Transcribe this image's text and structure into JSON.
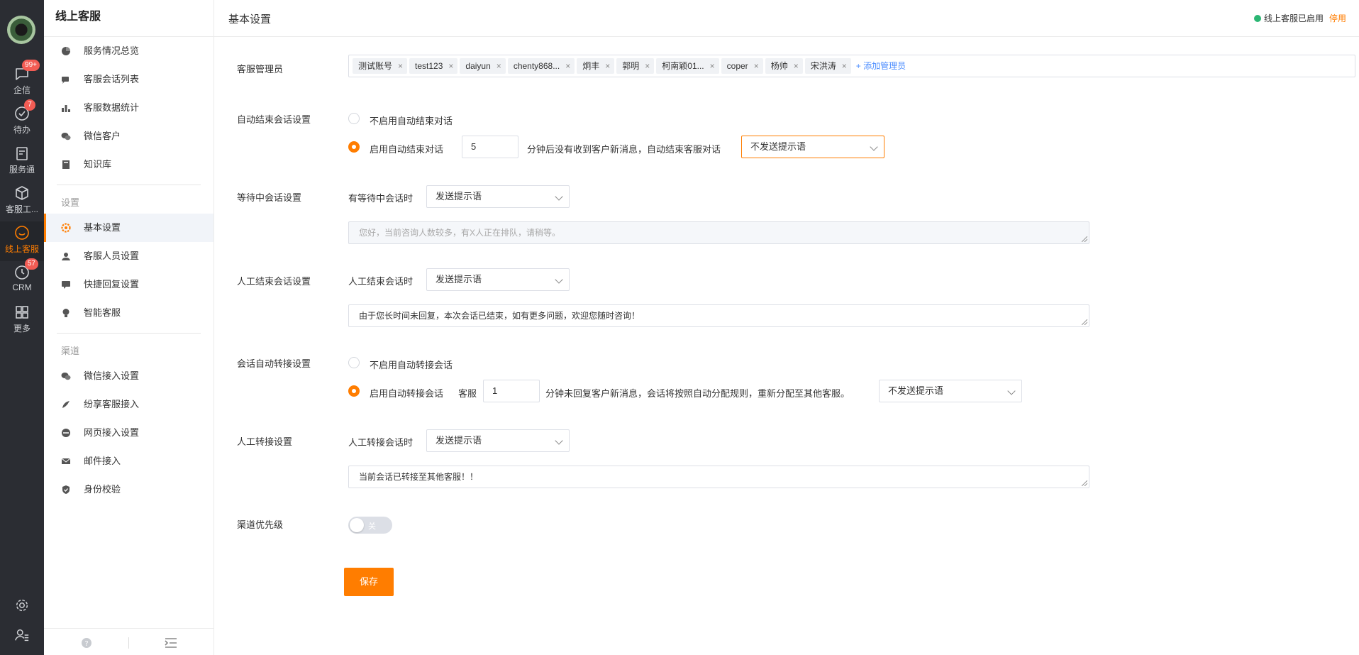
{
  "rail": {
    "items": [
      {
        "label": "企信",
        "badge": "99+"
      },
      {
        "label": "待办",
        "badge": "7"
      },
      {
        "label": "服务通",
        "badge": ""
      },
      {
        "label": "客服工...",
        "badge": ""
      },
      {
        "label": "线上客服",
        "badge": ""
      },
      {
        "label": "CRM",
        "badge": "57"
      },
      {
        "label": "更多",
        "badge": ""
      }
    ]
  },
  "sidebar": {
    "title": "线上客服",
    "items": [
      {
        "label": "服务情况总览"
      },
      {
        "label": "客服会话列表"
      },
      {
        "label": "客服数据统计"
      },
      {
        "label": "微信客户"
      },
      {
        "label": "知识库"
      }
    ],
    "group_settings": "设置",
    "settings_items": [
      {
        "label": "基本设置"
      },
      {
        "label": "客服人员设置"
      },
      {
        "label": "快捷回复设置"
      },
      {
        "label": "智能客服"
      }
    ],
    "group_channels": "渠道",
    "channel_items": [
      {
        "label": "微信接入设置"
      },
      {
        "label": "纷享客服接入"
      },
      {
        "label": "网页接入设置"
      },
      {
        "label": "邮件接入"
      },
      {
        "label": "身份校验"
      }
    ]
  },
  "header": {
    "title": "基本设置",
    "status_text": "线上客服已启用",
    "stop_label": "停用"
  },
  "admins": {
    "label": "客服管理员",
    "tags": [
      "测试账号",
      "test123",
      "daiyun",
      "chenty868...",
      "炯丰",
      "郭明",
      "柯南颖01...",
      "coper",
      "杨帅",
      "宋洪涛"
    ],
    "add_label": "+ 添加管理员"
  },
  "auto_end": {
    "label": "自动结束会话设置",
    "option_off": "不启用自动结束对话",
    "option_on": "启用自动结束对话",
    "minutes": "5",
    "desc": "分钟后没有收到客户新消息，自动结束客服对话",
    "select_value": "不发送提示语"
  },
  "waiting": {
    "label": "等待中会话设置",
    "prefix": "有等待中会话时",
    "select_value": "发送提示语",
    "placeholder": "您好，当前咨询人数较多，有X人正在排队，请稍等。"
  },
  "manual_end": {
    "label": "人工结束会话设置",
    "prefix": "人工结束会话时",
    "select_value": "发送提示语",
    "text": "由于您长时间未回复，本次会话已结束，如有更多问题，欢迎您随时咨询！"
  },
  "auto_transfer": {
    "label": "会话自动转接设置",
    "option_off": "不启用自动转接会话",
    "option_on": "启用自动转接会话",
    "agent_label": "客服",
    "minutes": "1",
    "desc": "分钟未回复客户新消息，会话将按照自动分配规则，重新分配至其他客服。",
    "select_value": "不发送提示语"
  },
  "manual_transfer": {
    "label": "人工转接设置",
    "prefix": "人工转接会话时",
    "select_value": "发送提示语",
    "text": "当前会话已转接至其他客服！！"
  },
  "channel_priority": {
    "label": "渠道优先级",
    "toggle_label": "关"
  },
  "save_label": "保存",
  "colors": {
    "accent": "#ff7d00",
    "rail": "#2b2d33",
    "link": "#4a8cff",
    "badge": "#f25c54"
  }
}
